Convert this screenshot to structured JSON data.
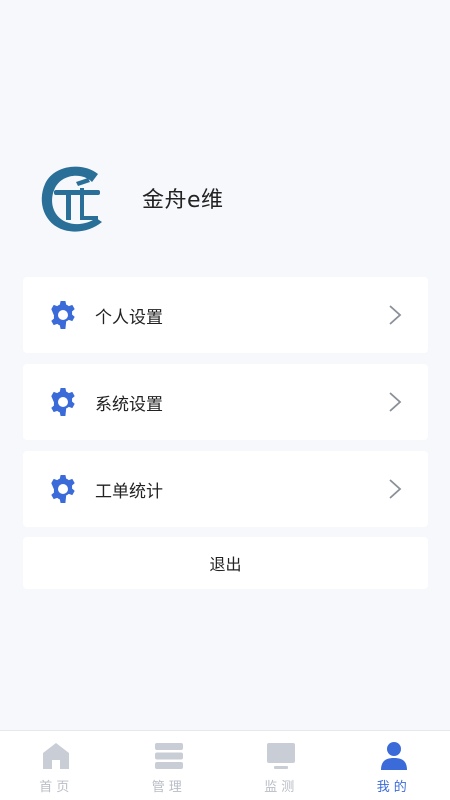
{
  "profile": {
    "app_name": "金舟e维"
  },
  "menu": [
    {
      "label": "个人设置",
      "icon": "gear-icon"
    },
    {
      "label": "系统设置",
      "icon": "gear-icon"
    },
    {
      "label": "工单统计",
      "icon": "gear-icon"
    }
  ],
  "logout_label": "退出",
  "tabbar": {
    "tabs": [
      {
        "label": "首页",
        "icon": "home-icon"
      },
      {
        "label": "管理",
        "icon": "list-icon"
      },
      {
        "label": "监测",
        "icon": "monitor-icon"
      },
      {
        "label": "我的",
        "icon": "user-icon"
      }
    ],
    "active_index": 3
  },
  "colors": {
    "accent": "#3b6bd9",
    "inactive": "#c9cdd6",
    "logo": "#2a6f97",
    "background": "#f7f8fc"
  }
}
